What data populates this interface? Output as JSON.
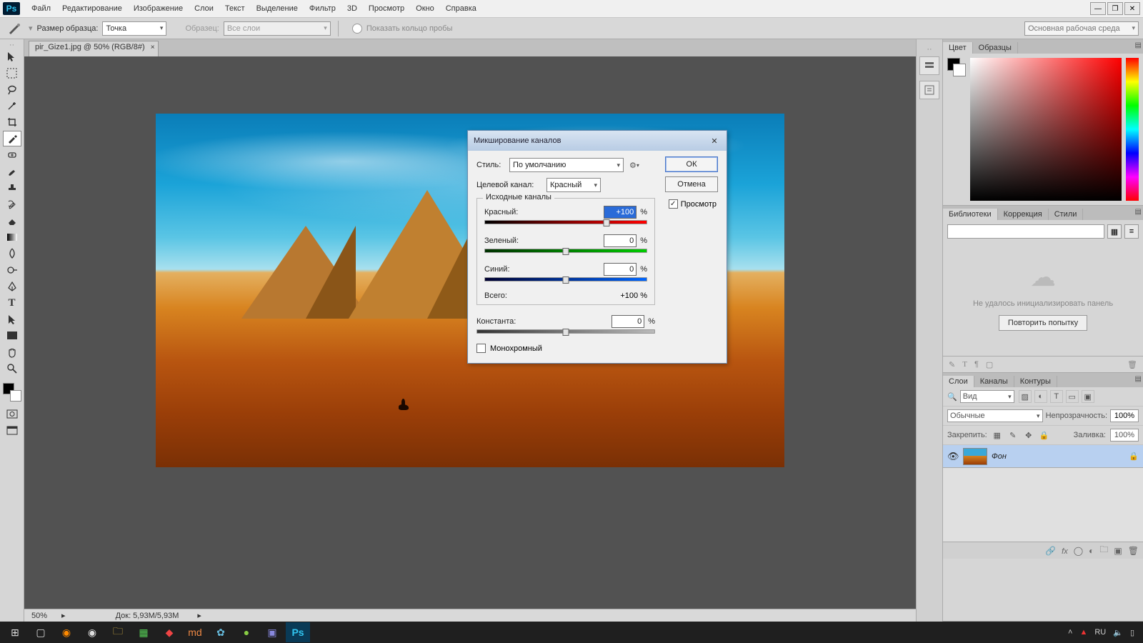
{
  "app": {
    "logo_text": "Ps"
  },
  "menu": [
    "Файл",
    "Редактирование",
    "Изображение",
    "Слои",
    "Текст",
    "Выделение",
    "Фильтр",
    "3D",
    "Просмотр",
    "Окно",
    "Справка"
  ],
  "options": {
    "sample_label": "Размер образца:",
    "sample_value": "Точка",
    "sample2_label": "Образец:",
    "sample2_value": "Все слои",
    "ring_label": "Показать кольцо пробы",
    "workspace": "Основная рабочая среда"
  },
  "doc_tab": {
    "title": "pir_Gize1.jpg @ 50% (RGB/8#)"
  },
  "status": {
    "zoom": "50%",
    "doc": "Док: 5,93M/5,93M"
  },
  "panels": {
    "color": {
      "tabs": [
        "Цвет",
        "Образцы"
      ]
    },
    "libraries": {
      "tabs": [
        "Библиотеки",
        "Коррекция",
        "Стили"
      ],
      "error": "Не удалось инициализировать панель",
      "retry": "Повторить попытку"
    },
    "styles_row": {
      "tabs": []
    },
    "layers": {
      "tabs": [
        "Слои",
        "Каналы",
        "Контуры"
      ],
      "kind": "Вид",
      "blend": "Обычные",
      "opacity_label": "Непрозрачность:",
      "opacity_value": "100%",
      "lock_label": "Закрепить:",
      "fill_label": "Заливка:",
      "fill_value": "100%",
      "layer_name": "Фон"
    }
  },
  "dialog": {
    "title": "Микширование каналов",
    "style_label": "Стиль:",
    "style_value": "По умолчанию",
    "target_label": "Целевой канал:",
    "target_value": "Красный",
    "ok": "ОК",
    "cancel": "Отмена",
    "preview": "Просмотр",
    "fieldset": "Исходные каналы",
    "red": "Красный:",
    "red_val": "+100",
    "green": "Зеленый:",
    "green_val": "0",
    "blue": "Синий:",
    "blue_val": "0",
    "total": "Всего:",
    "total_val": "+100  %",
    "constant": "Константа:",
    "constant_val": "0",
    "mono": "Монохромный",
    "pct": "%"
  },
  "tray": {
    "lang": "RU",
    "time": ""
  }
}
